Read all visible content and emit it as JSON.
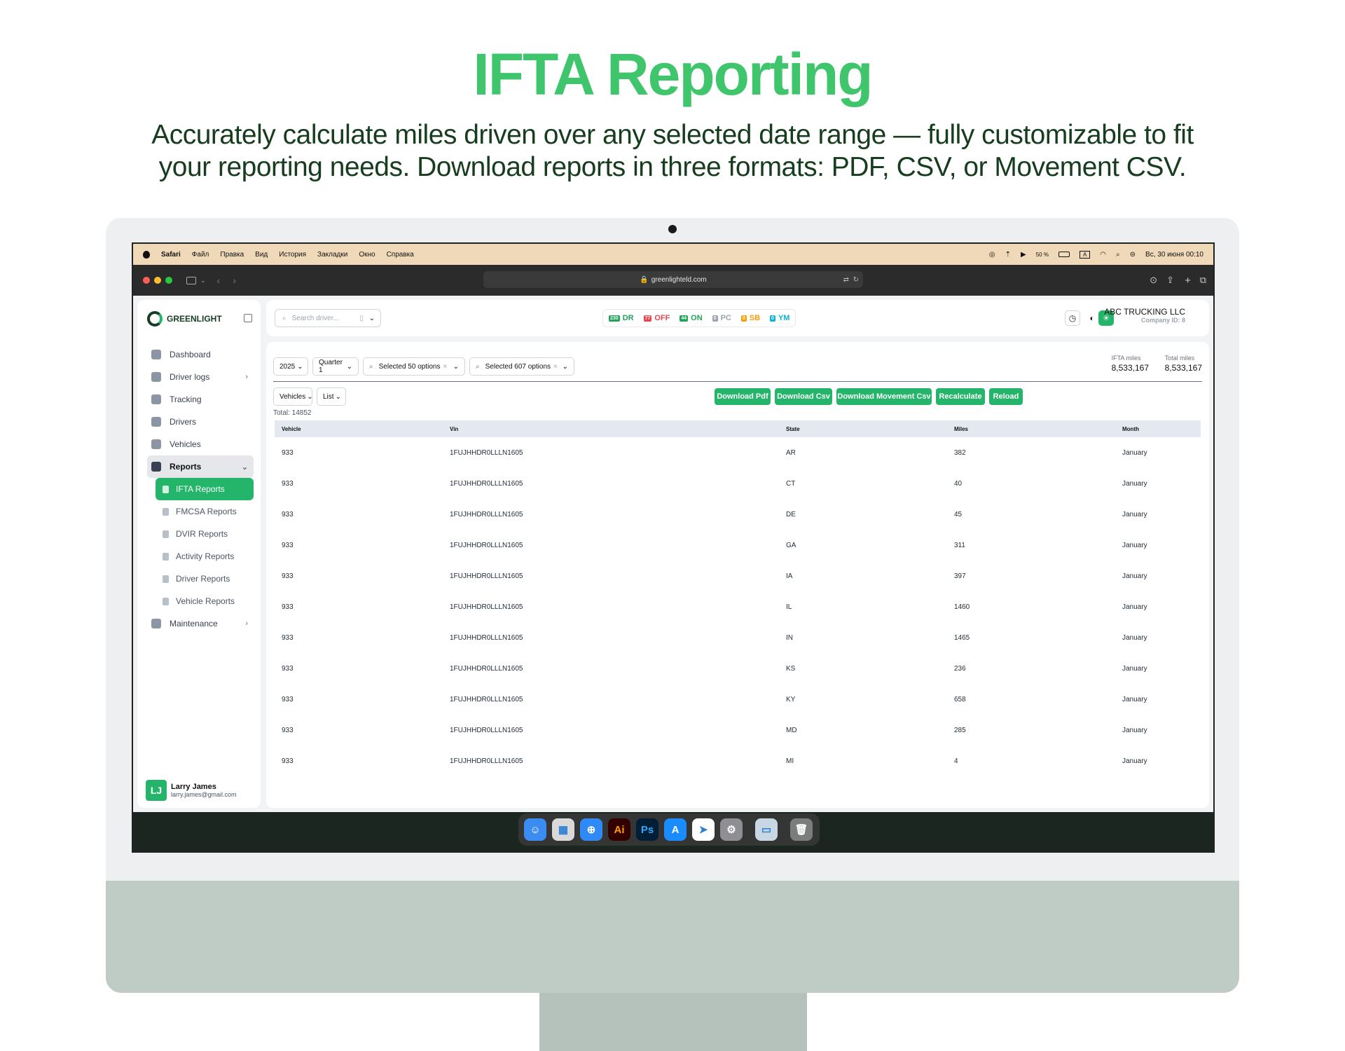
{
  "hero": {
    "title": "IFTA Reporting",
    "subtitle": "Accurately calculate miles driven over any selected date range — fully customizable to fit your reporting needs. Download reports in three formats: PDF, CSV, or Movement CSV."
  },
  "menubar": {
    "apple": "",
    "items": [
      "Safari",
      "Файл",
      "Правка",
      "Вид",
      "История",
      "Закладки",
      "Окно",
      "Справка"
    ],
    "battery": "50 %",
    "input": "A",
    "datetime": "Вс, 30 июня  00:10"
  },
  "browser": {
    "url": "greenlighteld.com"
  },
  "sidebar": {
    "brand": "GREENLIGHT",
    "items": [
      {
        "label": "Dashboard"
      },
      {
        "label": "Driver logs",
        "chevron": "›"
      },
      {
        "label": "Tracking"
      },
      {
        "label": "Drivers"
      },
      {
        "label": "Vehicles"
      },
      {
        "label": "Reports",
        "chevron": "⌄"
      }
    ],
    "reports_sub": [
      "IFTA Reports",
      "FMCSA Reports",
      "DVIR Reports",
      "Activity Reports",
      "Driver Reports",
      "Vehicle Reports"
    ],
    "maintenance": {
      "label": "Maintenance",
      "chevron": "›"
    },
    "user": {
      "initials": "LJ",
      "name": "Larry James",
      "email": "larry.james@gmail.com"
    }
  },
  "topbar": {
    "search_placeholder": "Search driver...",
    "statuses": [
      {
        "badge": "230",
        "label": "DR",
        "color": "#22a35a"
      },
      {
        "badge": "77",
        "label": "OFF",
        "color": "#e5484d"
      },
      {
        "badge": "44",
        "label": "ON",
        "color": "#22a35a"
      },
      {
        "badge": "0",
        "label": "PC",
        "color": "#9ca3af"
      },
      {
        "badge": "0",
        "label": "SB",
        "color": "#f59e0b"
      },
      {
        "badge": "0",
        "label": "YM",
        "color": "#06b6d4"
      }
    ],
    "company_name": "ABC TRUCKING LLC",
    "company_id": "Company ID: 8"
  },
  "filters": {
    "year": "2025",
    "quarter": "Quarter 1",
    "vehicles_selected": "Selected 50 options",
    "states_selected": "Selected 607 options",
    "ifta_miles_label": "IFTA miles",
    "ifta_miles_value": "8,533,167",
    "total_miles_label": "Total miles",
    "total_miles_value": "8,533,167",
    "group_by": "Vehicles",
    "view": "List"
  },
  "actions": {
    "download_pdf": "Download Pdf",
    "download_csv": "Download Csv",
    "download_movement_csv": "Download Movement Csv",
    "recalculate": "Recalculate",
    "reload": "Reload"
  },
  "total_label": "Total: 14852",
  "table": {
    "headers": [
      "Vehicle",
      "Vin",
      "State",
      "Miles",
      "Month"
    ],
    "rows": [
      [
        "933",
        "1FUJHHDR0LLLN1605",
        "AR",
        "382",
        "January"
      ],
      [
        "933",
        "1FUJHHDR0LLLN1605",
        "CT",
        "40",
        "January"
      ],
      [
        "933",
        "1FUJHHDR0LLLN1605",
        "DE",
        "45",
        "January"
      ],
      [
        "933",
        "1FUJHHDR0LLLN1605",
        "GA",
        "311",
        "January"
      ],
      [
        "933",
        "1FUJHHDR0LLLN1605",
        "IA",
        "397",
        "January"
      ],
      [
        "933",
        "1FUJHHDR0LLLN1605",
        "IL",
        "1460",
        "January"
      ],
      [
        "933",
        "1FUJHHDR0LLLN1605",
        "IN",
        "1465",
        "January"
      ],
      [
        "933",
        "1FUJHHDR0LLLN1605",
        "KS",
        "236",
        "January"
      ],
      [
        "933",
        "1FUJHHDR0LLLN1605",
        "KY",
        "658",
        "January"
      ],
      [
        "933",
        "1FUJHHDR0LLLN1605",
        "MD",
        "285",
        "January"
      ],
      [
        "933",
        "1FUJHHDR0LLLN1605",
        "MI",
        "4",
        "January"
      ]
    ]
  },
  "dock": {
    "apps": [
      {
        "name": "finder-icon",
        "glyph": "☺",
        "color": "#3b8cf0"
      },
      {
        "name": "launchpad-icon",
        "glyph": "▦",
        "color": "#d9d9d9"
      },
      {
        "name": "safari-icon",
        "glyph": "⊕",
        "color": "#2f8af5"
      },
      {
        "name": "illustrator-icon",
        "glyph": "Ai",
        "color": "#330000"
      },
      {
        "name": "photoshop-icon",
        "glyph": "Ps",
        "color": "#001e36"
      },
      {
        "name": "app-store-icon",
        "glyph": "A",
        "color": "#1a8cff"
      },
      {
        "name": "telegram-icon",
        "glyph": "➤",
        "color": "#ffffff"
      },
      {
        "name": "system-settings-icon",
        "glyph": "⚙",
        "color": "#8e8e93"
      },
      {
        "name": "preview-icon",
        "glyph": "▭",
        "color": "#c9d6e3"
      },
      {
        "name": "trash-icon",
        "glyph": "🗑",
        "color": "#7c7c7c"
      }
    ]
  }
}
